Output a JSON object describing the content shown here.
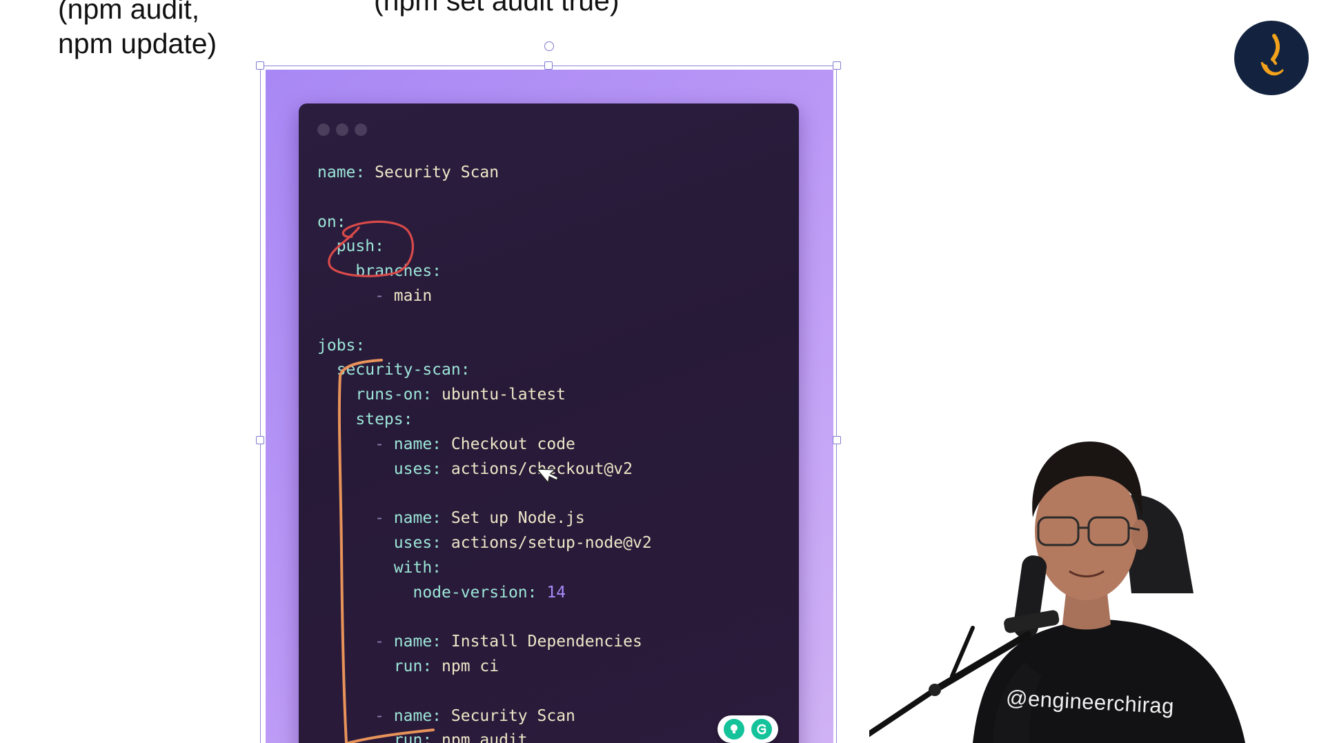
{
  "notes": {
    "left_line1": "(npm audit,",
    "left_line2": "npm update)",
    "top": "(npm set audit true)"
  },
  "code_window": {
    "lines": [
      [
        {
          "t": "name: ",
          "c": "k"
        },
        {
          "t": "Security Scan",
          "c": "v"
        }
      ],
      [],
      [
        {
          "t": "on:",
          "c": "k"
        }
      ],
      [
        {
          "t": "  push:",
          "c": "k"
        }
      ],
      [
        {
          "t": "    branches:",
          "c": "k"
        }
      ],
      [
        {
          "t": "      - ",
          "c": "dash"
        },
        {
          "t": "main",
          "c": "v"
        }
      ],
      [],
      [
        {
          "t": "jobs:",
          "c": "k"
        }
      ],
      [
        {
          "t": "  security-scan:",
          "c": "k"
        }
      ],
      [
        {
          "t": "    runs-on: ",
          "c": "k"
        },
        {
          "t": "ubuntu-latest",
          "c": "v"
        }
      ],
      [
        {
          "t": "    steps:",
          "c": "k"
        }
      ],
      [
        {
          "t": "      - ",
          "c": "dash"
        },
        {
          "t": "name: ",
          "c": "k"
        },
        {
          "t": "Checkout code",
          "c": "v"
        }
      ],
      [
        {
          "t": "        uses: ",
          "c": "k"
        },
        {
          "t": "actions/checkout@v2",
          "c": "v"
        }
      ],
      [],
      [
        {
          "t": "      - ",
          "c": "dash"
        },
        {
          "t": "name: ",
          "c": "k"
        },
        {
          "t": "Set up Node.js",
          "c": "v"
        }
      ],
      [
        {
          "t": "        uses: ",
          "c": "k"
        },
        {
          "t": "actions/setup-node@v2",
          "c": "v"
        }
      ],
      [
        {
          "t": "        with:",
          "c": "k"
        }
      ],
      [
        {
          "t": "          node-version: ",
          "c": "k"
        },
        {
          "t": "14",
          "c": "n"
        }
      ],
      [],
      [
        {
          "t": "      - ",
          "c": "dash"
        },
        {
          "t": "name: ",
          "c": "k"
        },
        {
          "t": "Install Dependencies",
          "c": "v"
        }
      ],
      [
        {
          "t": "        run: ",
          "c": "k"
        },
        {
          "t": "npm ci",
          "c": "v"
        }
      ],
      [],
      [
        {
          "t": "      - ",
          "c": "dash"
        },
        {
          "t": "name: ",
          "c": "k"
        },
        {
          "t": "Security Scan",
          "c": "v"
        }
      ],
      [
        {
          "t": "        run: ",
          "c": "k"
        },
        {
          "t": "npm audit",
          "c": "v"
        }
      ]
    ]
  },
  "presenter": {
    "handle": "@engineerchirag"
  },
  "colors": {
    "card_gradient_start": "#a888f4",
    "card_gradient_end": "#d0b2f5",
    "code_bg": "#2b1d3e",
    "annotation_red": "#d94a4a",
    "annotation_orange": "#e8935a",
    "logo_bg": "#13233f",
    "logo_accent": "#f2a21b",
    "grammarly_green": "#15c39a"
  },
  "icons": {
    "logo": "channel-logo-icon",
    "cursor": "arrow-cursor-icon",
    "badge_left": "lightbulb-icon",
    "badge_right": "grammarly-g-icon"
  }
}
